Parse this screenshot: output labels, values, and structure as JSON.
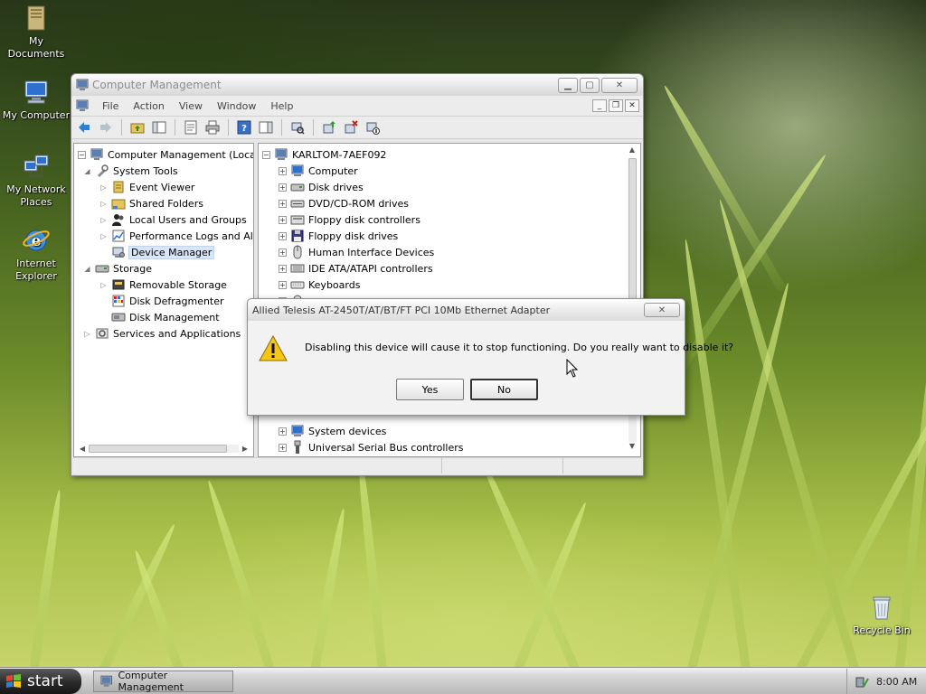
{
  "desktop": {
    "icons": [
      {
        "label": "My Documents",
        "icon": "folder-documents-icon"
      },
      {
        "label": "My Computer",
        "icon": "computer-icon"
      },
      {
        "label": "My Network Places",
        "icon": "network-icon"
      },
      {
        "label": "Internet Explorer",
        "icon": "internet-explorer-icon"
      },
      {
        "label": "Recycle Bin",
        "icon": "recycle-bin-icon"
      }
    ]
  },
  "window": {
    "title": "Computer Management",
    "menu": [
      "File",
      "Action",
      "View",
      "Window",
      "Help"
    ],
    "tree": [
      {
        "label": "Computer Management (Local)",
        "icon": "computer-management-icon"
      },
      {
        "label": "System Tools",
        "icon": "tools-icon"
      },
      {
        "label": "Event Viewer",
        "icon": "event-viewer-icon"
      },
      {
        "label": "Shared Folders",
        "icon": "shared-folders-icon"
      },
      {
        "label": "Local Users and Groups",
        "icon": "users-icon"
      },
      {
        "label": "Performance Logs and Alert",
        "icon": "performance-icon"
      },
      {
        "label": "Device Manager",
        "icon": "device-manager-icon"
      },
      {
        "label": "Storage",
        "icon": "storage-icon"
      },
      {
        "label": "Removable Storage",
        "icon": "removable-storage-icon"
      },
      {
        "label": "Disk Defragmenter",
        "icon": "defragmenter-icon"
      },
      {
        "label": "Disk Management",
        "icon": "disk-management-icon"
      },
      {
        "label": "Services and Applications",
        "icon": "services-icon"
      }
    ],
    "devices": {
      "root": "KARLTOM-7AEF092",
      "items": [
        {
          "label": "Computer",
          "icon": "computer-icon"
        },
        {
          "label": "Disk drives",
          "icon": "disk-drive-icon"
        },
        {
          "label": "DVD/CD-ROM drives",
          "icon": "dvd-drive-icon"
        },
        {
          "label": "Floppy disk controllers",
          "icon": "floppy-controller-icon"
        },
        {
          "label": "Floppy disk drives",
          "icon": "floppy-drive-icon"
        },
        {
          "label": "Human Interface Devices",
          "icon": "hid-icon"
        },
        {
          "label": "IDE ATA/ATAPI controllers",
          "icon": "ide-controller-icon"
        },
        {
          "label": "Keyboards",
          "icon": "keyboard-icon"
        },
        {
          "label": "System devices",
          "icon": "system-devices-icon"
        },
        {
          "label": "Universal Serial Bus controllers",
          "icon": "usb-icon"
        }
      ]
    }
  },
  "dialog": {
    "title": "Allied Telesis AT-2450T/AT/BT/FT PCI 10Mb Ethernet Adapter",
    "message": "Disabling this device will cause it to stop functioning. Do you really want to disable it?",
    "yes_label": "Yes",
    "no_label": "No"
  },
  "taskbar": {
    "start_label": "start",
    "task_label": "Computer Management",
    "clock": "8:00 AM"
  }
}
